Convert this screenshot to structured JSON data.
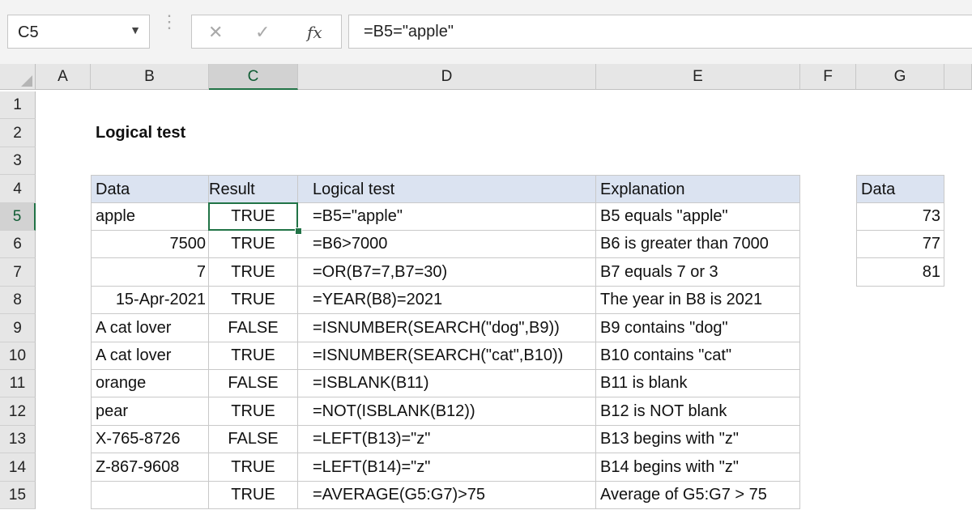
{
  "formula_bar": {
    "name_box": "C5",
    "name_box_arrow": "▼",
    "grip": "⋮",
    "cancel_icon": "✕",
    "enter_icon": "✓",
    "fx_label": "fx",
    "formula": "=B5=\"apple\""
  },
  "columns": [
    "A",
    "B",
    "C",
    "D",
    "E",
    "F",
    "G"
  ],
  "selected_column": "C",
  "rows": [
    "1",
    "2",
    "3",
    "4",
    "5",
    "6",
    "7",
    "8",
    "9",
    "10",
    "11",
    "12",
    "13",
    "14",
    "15"
  ],
  "selected_row": "5",
  "sheet_title": "Logical test",
  "main_table": {
    "headers": [
      "Data",
      "Result",
      "Logical test",
      "Explanation"
    ],
    "rows": [
      [
        "apple",
        "TRUE",
        "=B5=\"apple\"",
        "B5 equals \"apple\""
      ],
      [
        "7500",
        "TRUE",
        "=B6>7000",
        "B6 is greater than 7000"
      ],
      [
        "7",
        "TRUE",
        "=OR(B7=7,B7=30)",
        "B7 equals 7 or 3"
      ],
      [
        "15-Apr-2021",
        "TRUE",
        "=YEAR(B8)=2021",
        "The year in B8 is 2021"
      ],
      [
        "A cat lover",
        "FALSE",
        "=ISNUMBER(SEARCH(\"dog\",B9))",
        "B9 contains \"dog\""
      ],
      [
        "A cat lover",
        "TRUE",
        "=ISNUMBER(SEARCH(\"cat\",B10))",
        "B10 contains \"cat\""
      ],
      [
        "orange",
        "FALSE",
        "=ISBLANK(B11)",
        "B11 is blank"
      ],
      [
        "pear",
        "TRUE",
        "=NOT(ISBLANK(B12))",
        "B12 is NOT blank"
      ],
      [
        "X-765-8726",
        "FALSE",
        "=LEFT(B13)=\"z\"",
        "B13 begins with \"z\""
      ],
      [
        "Z-867-9608",
        "TRUE",
        "=LEFT(B14)=\"z\"",
        "B14 begins with \"z\""
      ],
      [
        "",
        "TRUE",
        "=AVERAGE(G5:G7)>75",
        "Average of G5:G7 > 75"
      ]
    ]
  },
  "side_table": {
    "header": "Data",
    "values": [
      "73",
      "77",
      "81"
    ]
  },
  "colors": {
    "header_fill": "#dbe3f1",
    "accent": "#217346"
  }
}
